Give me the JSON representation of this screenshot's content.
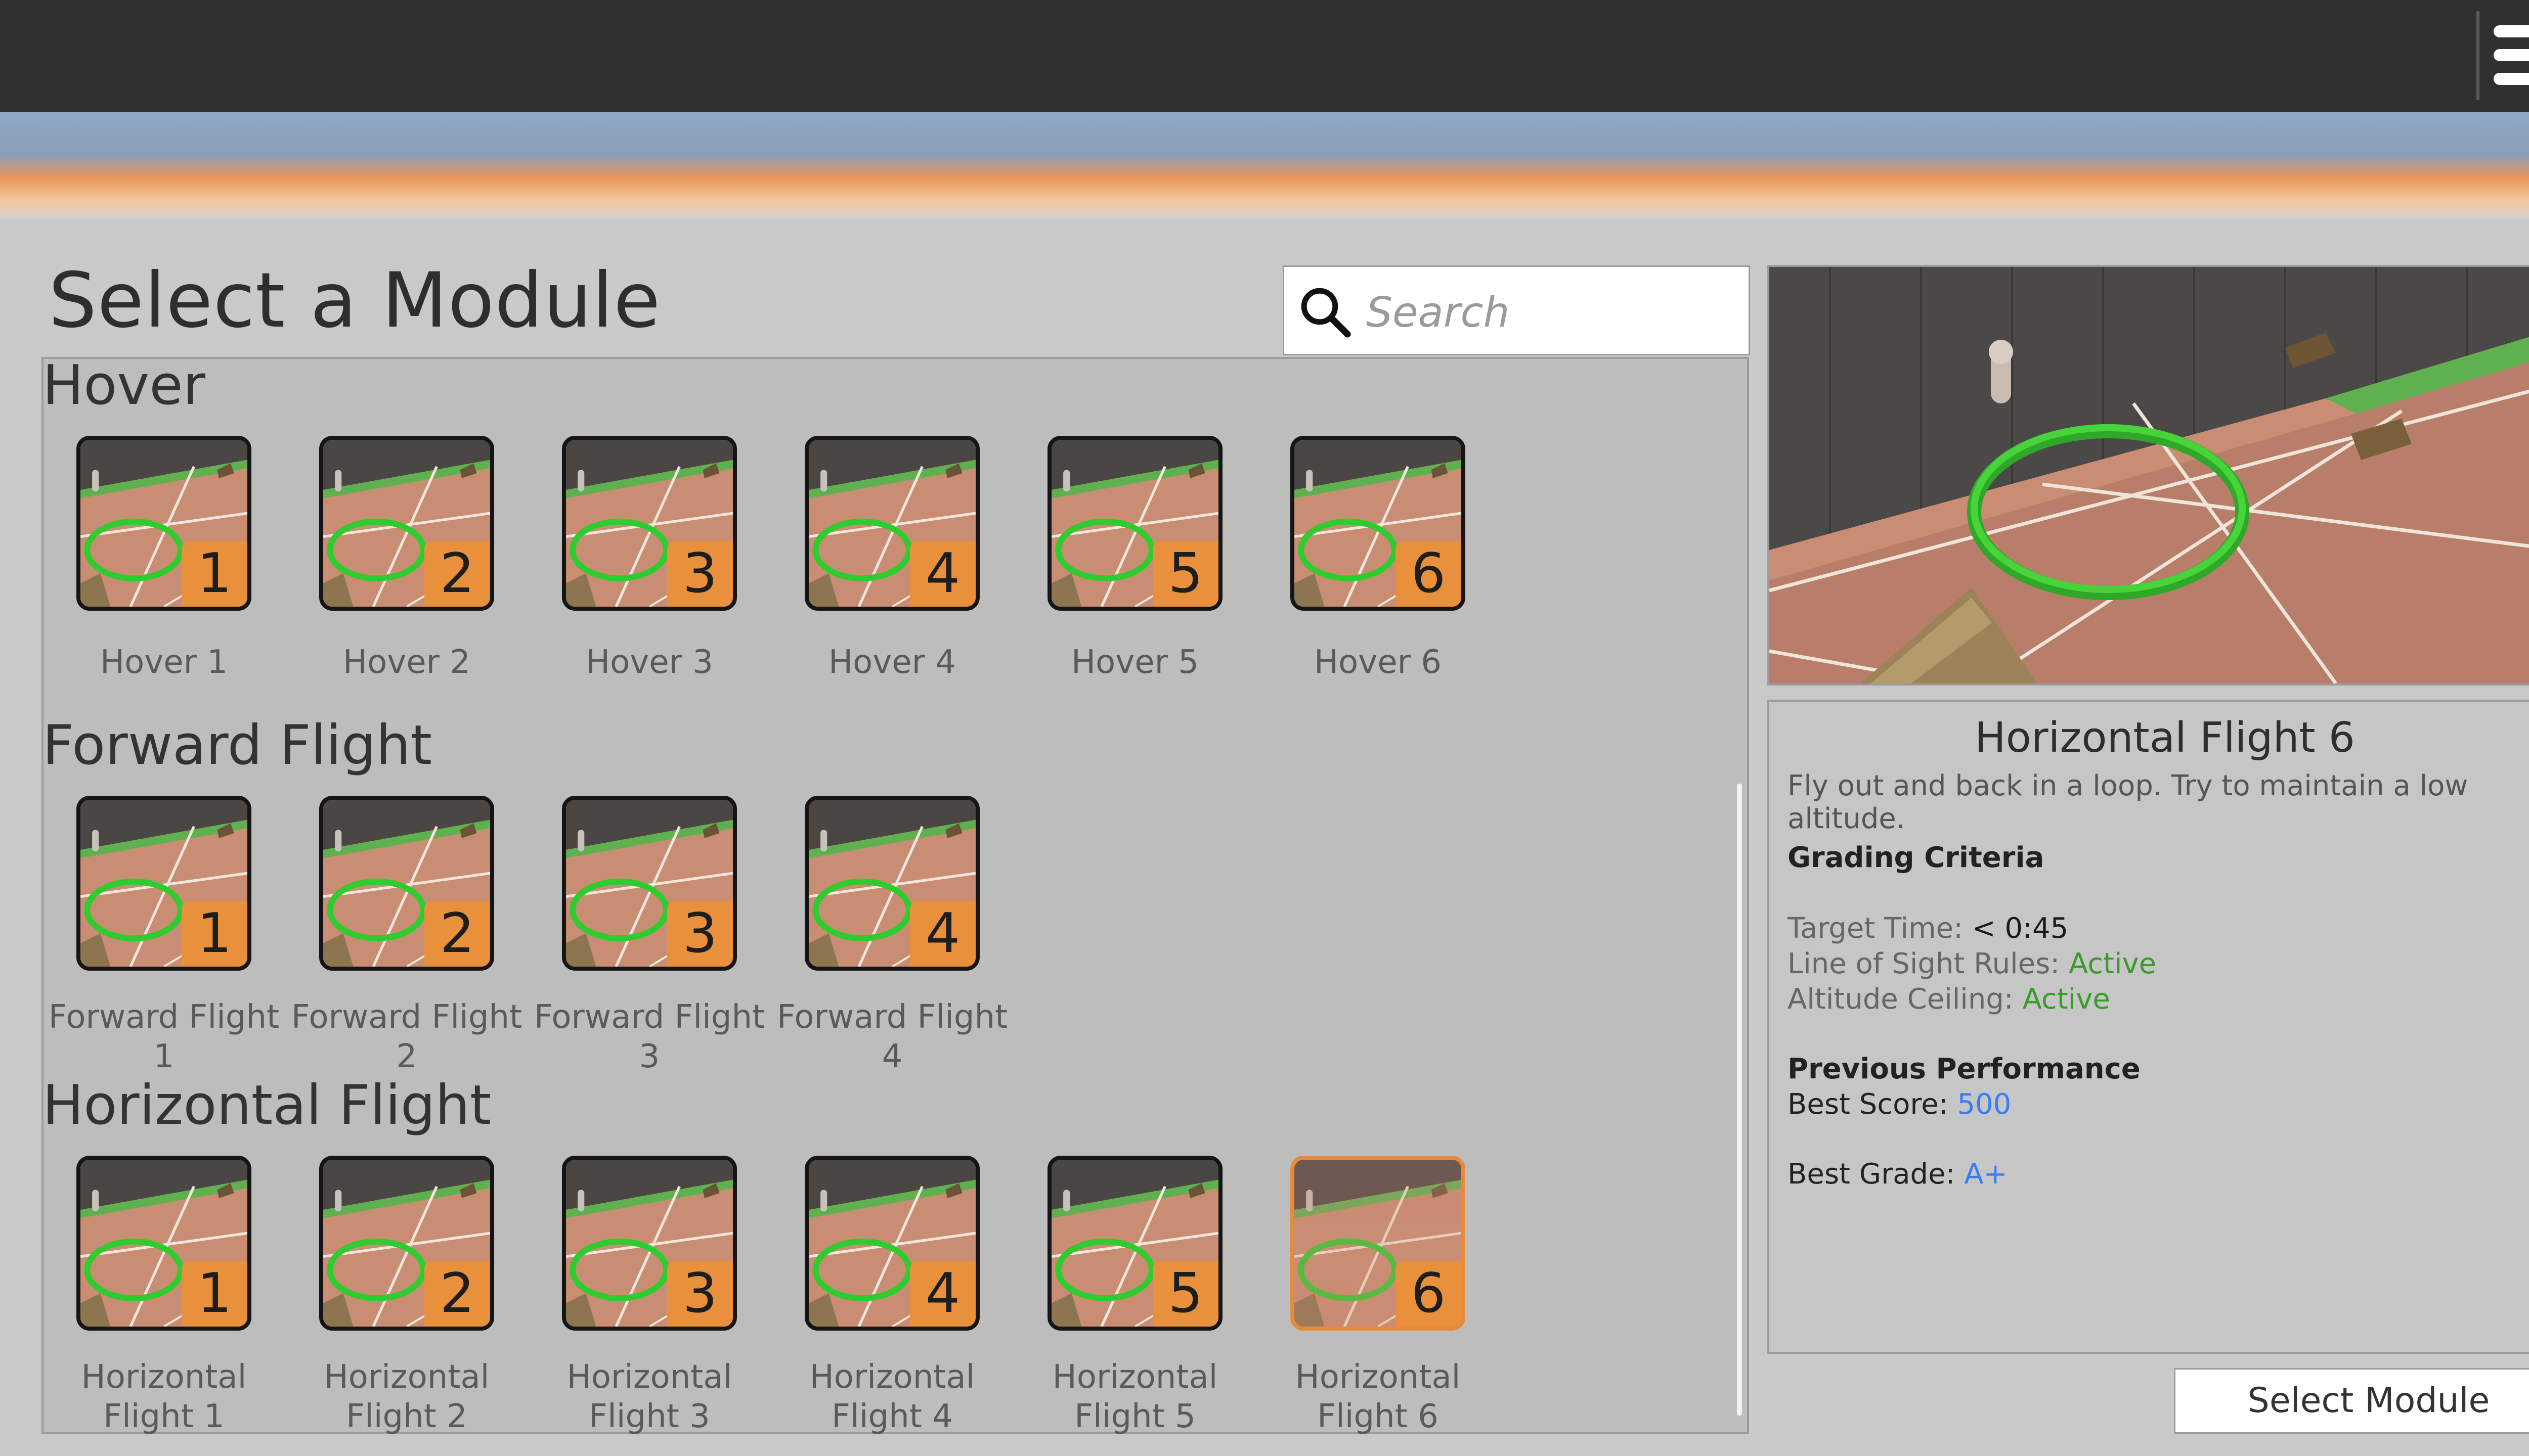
{
  "menu": {
    "icon": "hamburger-menu-icon"
  },
  "page_title": "Select a Module",
  "search": {
    "placeholder": "Search",
    "icon": "search-icon"
  },
  "sections": [
    {
      "title": "Hover",
      "modules": [
        {
          "number": "1",
          "label": "Hover 1"
        },
        {
          "number": "2",
          "label": "Hover 2"
        },
        {
          "number": "3",
          "label": "Hover 3"
        },
        {
          "number": "4",
          "label": "Hover 4"
        },
        {
          "number": "5",
          "label": "Hover 5"
        },
        {
          "number": "6",
          "label": "Hover 6"
        }
      ]
    },
    {
      "title": "Forward Flight",
      "modules": [
        {
          "number": "1",
          "label_line1": "Forward Flight",
          "label_line2": "1"
        },
        {
          "number": "2",
          "label_line1": "Forward Flight",
          "label_line2": "2"
        },
        {
          "number": "3",
          "label_line1": "Forward Flight",
          "label_line2": "3"
        },
        {
          "number": "4",
          "label_line1": "Forward Flight",
          "label_line2": "4"
        }
      ]
    },
    {
      "title": "Horizontal Flight",
      "modules": [
        {
          "number": "1",
          "label_line1": "Horizontal",
          "label_line2": "Flight 1"
        },
        {
          "number": "2",
          "label_line1": "Horizontal",
          "label_line2": "Flight 2"
        },
        {
          "number": "3",
          "label_line1": "Horizontal",
          "label_line2": "Flight 3"
        },
        {
          "number": "4",
          "label_line1": "Horizontal",
          "label_line2": "Flight 4"
        },
        {
          "number": "5",
          "label_line1": "Horizontal",
          "label_line2": "Flight 5"
        },
        {
          "number": "6",
          "label_line1": "Horizontal",
          "label_line2": "Flight 6",
          "selected": true
        }
      ]
    }
  ],
  "details": {
    "title": "Horizontal Flight 6",
    "description": "Fly out and back in a loop. Try to maintain a low altitude.",
    "grading_heading": "Grading Criteria",
    "target_time_label": "Target Time:",
    "target_time_value": "< 0:45",
    "line_of_sight_label": "Line of Sight Rules:",
    "line_of_sight_value": "Active",
    "altitude_label": "Altitude Ceiling:",
    "altitude_value": "Active",
    "performance_heading": "Previous Performance",
    "best_score_label": "Best Score:",
    "best_score_value": "500",
    "best_grade_label": "Best Grade:",
    "best_grade_value": "A+"
  },
  "select_button": "Select Module",
  "colors": {
    "accent_orange": "#e9903c",
    "active_green": "#3a9a2a",
    "value_blue": "#3a7cf5",
    "top_bar": "#303030"
  }
}
